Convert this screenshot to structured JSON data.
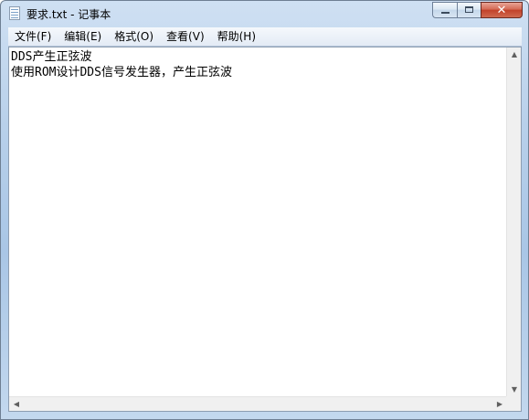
{
  "window": {
    "title": "要求.txt - 记事本",
    "icon": "notepad-icon"
  },
  "caption_buttons": {
    "minimize_icon": "minimize-icon",
    "maximize_icon": "maximize-icon",
    "close_glyph": "✕"
  },
  "menu": {
    "items": [
      {
        "label": "文件(F)"
      },
      {
        "label": "编辑(E)"
      },
      {
        "label": "格式(O)"
      },
      {
        "label": "查看(V)"
      },
      {
        "label": "帮助(H)"
      }
    ]
  },
  "editor": {
    "lines": [
      "DDS产生正弦波",
      "使用ROM设计DDS信号发生器，产生正弦波"
    ]
  },
  "scrollbars": {
    "up_arrow": "▲",
    "down_arrow": "▼",
    "left_arrow": "◀",
    "right_arrow": "▶"
  }
}
